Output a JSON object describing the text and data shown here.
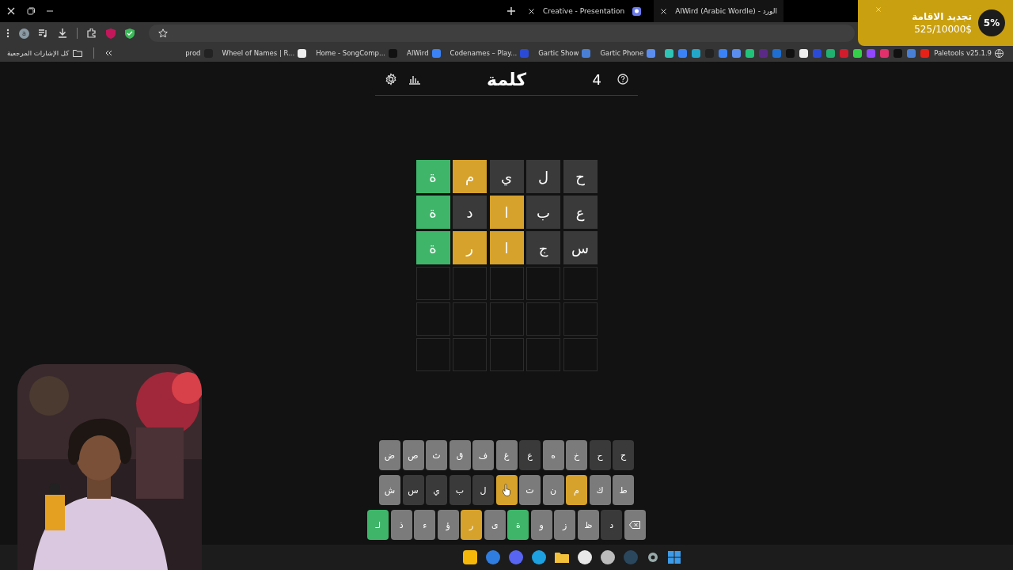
{
  "tabs": [
    {
      "title": "Creative - Presentation",
      "selected": false
    },
    {
      "title": "AlWird (Arabic Wordle) - الورد",
      "selected": true
    }
  ],
  "toolbar": {
    "profile_initial": "a"
  },
  "bookmarks_bar": {
    "all_bookmarks": "كل الإشارات المرجعية",
    "items": [
      {
        "kind": "link",
        "label": "prod"
      },
      {
        "kind": "link",
        "label": "Wheel of Names | R..."
      },
      {
        "kind": "link",
        "label": "Home - SongComp..."
      },
      {
        "kind": "link",
        "label": "AlWird"
      },
      {
        "kind": "link",
        "label": "Codenames – Play..."
      },
      {
        "kind": "link",
        "label": "Gartic Show"
      },
      {
        "kind": "link",
        "label": "Gartic Phone"
      },
      {
        "kind": "icon"
      },
      {
        "kind": "icon"
      },
      {
        "kind": "icon"
      },
      {
        "kind": "icon"
      },
      {
        "kind": "icon"
      },
      {
        "kind": "icon"
      },
      {
        "kind": "icon"
      },
      {
        "kind": "icon"
      },
      {
        "kind": "icon"
      },
      {
        "kind": "icon"
      },
      {
        "kind": "icon"
      },
      {
        "kind": "icon"
      },
      {
        "kind": "icon"
      },
      {
        "kind": "icon"
      },
      {
        "kind": "icon"
      },
      {
        "kind": "icon"
      },
      {
        "kind": "icon"
      },
      {
        "kind": "icon"
      },
      {
        "kind": "icon"
      },
      {
        "kind": "icon"
      },
      {
        "kind": "link",
        "label": "Paletools v25.1.9"
      }
    ]
  },
  "notification": {
    "title": "تجديد الاقامة",
    "amount": "525/10000$",
    "percent": "5%"
  },
  "game": {
    "title": "كلمة",
    "count": "4",
    "rows": [
      {
        "empty": false,
        "tiles": [
          {
            "letter": "ح",
            "color": "#3a3a3a"
          },
          {
            "letter": "ل",
            "color": "#3a3a3a"
          },
          {
            "letter": "ي",
            "color": "#3a3a3a"
          },
          {
            "letter": "م",
            "color": "#d6a22b"
          },
          {
            "letter": "ة",
            "color": "#3fb56a"
          }
        ]
      },
      {
        "empty": false,
        "tiles": [
          {
            "letter": "ع",
            "color": "#3a3a3a"
          },
          {
            "letter": "ب",
            "color": "#3a3a3a"
          },
          {
            "letter": "ا",
            "color": "#d6a22b"
          },
          {
            "letter": "د",
            "color": "#3a3a3a"
          },
          {
            "letter": "ة",
            "color": "#3fb56a"
          }
        ]
      },
      {
        "empty": false,
        "tiles": [
          {
            "letter": "س",
            "color": "#3a3a3a"
          },
          {
            "letter": "ج",
            "color": "#3a3a3a"
          },
          {
            "letter": "ا",
            "color": "#d6a22b"
          },
          {
            "letter": "ر",
            "color": "#d6a22b"
          },
          {
            "letter": "ة",
            "color": "#3fb56a"
          }
        ]
      },
      {
        "empty": true
      },
      {
        "empty": true
      },
      {
        "empty": true
      }
    ],
    "keyboard": [
      {
        "keys": [
          {
            "kind": "letter",
            "label": "ج",
            "color": "#3a3a3a"
          },
          {
            "kind": "letter",
            "label": "ح",
            "color": "#3a3a3a"
          },
          {
            "kind": "letter",
            "label": "خ",
            "color": "#7b7b7b"
          },
          {
            "kind": "letter",
            "label": "ه",
            "color": "#7b7b7b"
          },
          {
            "kind": "letter",
            "label": "ع",
            "color": "#3a3a3a"
          },
          {
            "kind": "letter",
            "label": "غ",
            "color": "#7b7b7b"
          },
          {
            "kind": "letter",
            "label": "ف",
            "color": "#7b7b7b"
          },
          {
            "kind": "letter",
            "label": "ق",
            "color": "#7b7b7b"
          },
          {
            "kind": "letter",
            "label": "ث",
            "color": "#7b7b7b"
          },
          {
            "kind": "letter",
            "label": "ص",
            "color": "#7b7b7b"
          },
          {
            "kind": "letter",
            "label": "ض",
            "color": "#7b7b7b"
          }
        ]
      },
      {
        "keys": [
          {
            "kind": "letter",
            "label": "ط",
            "color": "#7b7b7b"
          },
          {
            "kind": "letter",
            "label": "ك",
            "color": "#7b7b7b"
          },
          {
            "kind": "letter",
            "label": "م",
            "color": "#d6a22b"
          },
          {
            "kind": "letter",
            "label": "ن",
            "color": "#7b7b7b"
          },
          {
            "kind": "letter",
            "label": "ت",
            "color": "#7b7b7b"
          },
          {
            "kind": "hovered",
            "color": "#d6a22b"
          },
          {
            "kind": "letter",
            "label": "ل",
            "color": "#3a3a3a"
          },
          {
            "kind": "letter",
            "label": "ب",
            "color": "#3a3a3a"
          },
          {
            "kind": "letter",
            "label": "ي",
            "color": "#3a3a3a"
          },
          {
            "kind": "letter",
            "label": "س",
            "color": "#3a3a3a"
          },
          {
            "kind": "letter",
            "label": "ش",
            "color": "#7b7b7b"
          }
        ]
      },
      {
        "keys": [
          {
            "kind": "backspace",
            "color": "#7b7b7b"
          },
          {
            "kind": "letter",
            "label": "د",
            "color": "#3a3a3a"
          },
          {
            "kind": "letter",
            "label": "ظ",
            "color": "#7b7b7b"
          },
          {
            "kind": "letter",
            "label": "ز",
            "color": "#7b7b7b"
          },
          {
            "kind": "letter",
            "label": "و",
            "color": "#7b7b7b"
          },
          {
            "kind": "letter",
            "label": "ة",
            "color": "#3fb56a"
          },
          {
            "kind": "letter",
            "label": "ى",
            "color": "#7b7b7b"
          },
          {
            "kind": "letter",
            "label": "ر",
            "color": "#d6a22b"
          },
          {
            "kind": "letter",
            "label": "ؤ",
            "color": "#7b7b7b"
          },
          {
            "kind": "letter",
            "label": "ء",
            "color": "#7b7b7b"
          },
          {
            "kind": "letter",
            "label": "ذ",
            "color": "#7b7b7b"
          },
          {
            "kind": "letter",
            "label": "لـ",
            "color": "#3fb56a"
          }
        ]
      }
    ]
  }
}
